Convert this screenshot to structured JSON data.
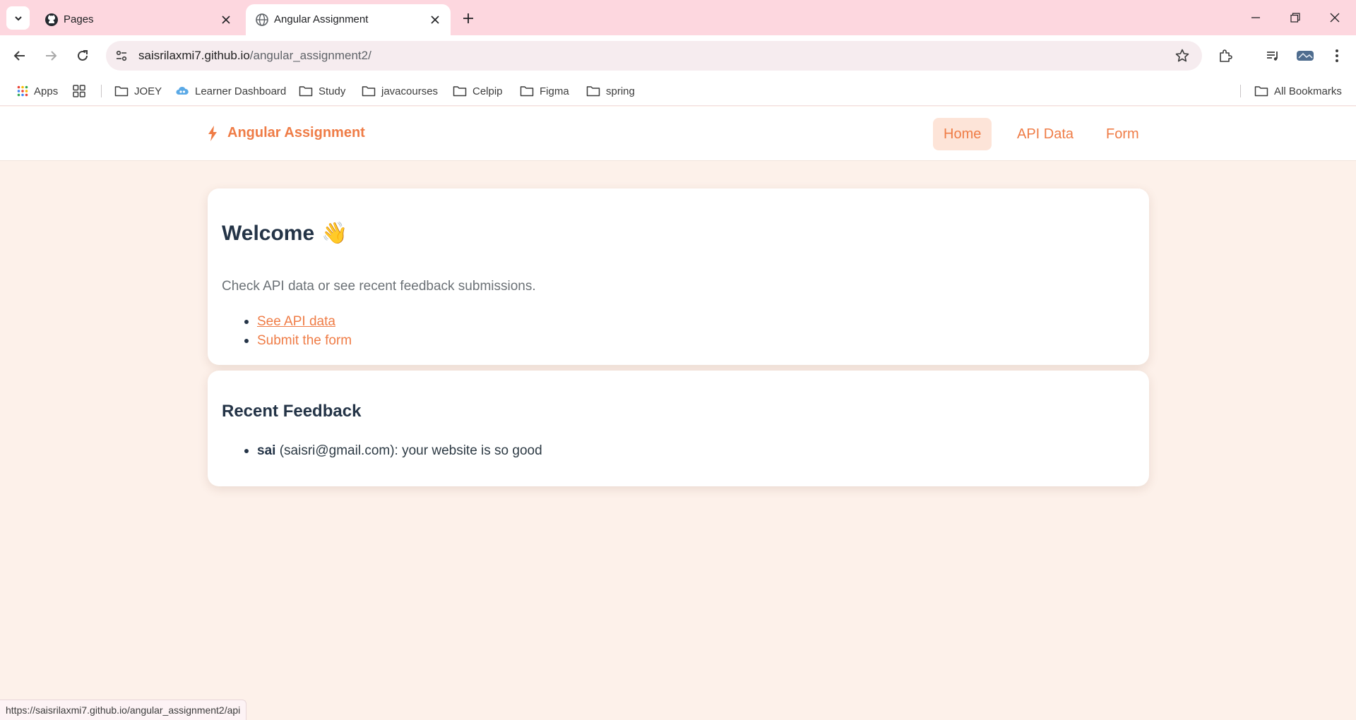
{
  "browser": {
    "tabs": [
      {
        "title": "Pages",
        "icon": "github-icon",
        "active": false
      },
      {
        "title": "Angular Assignment",
        "icon": "globe-icon",
        "active": true
      }
    ],
    "address": {
      "host": "saisrilaxmi7.github.io",
      "path": "/angular_assignment2/"
    },
    "bookmarks": [
      {
        "label": "Apps",
        "icon": "apps-grid-icon"
      },
      {
        "label": "JOEY",
        "icon": "folder-icon"
      },
      {
        "label": "Learner Dashboard",
        "icon": "cloud-icon"
      },
      {
        "label": "Study",
        "icon": "folder-icon"
      },
      {
        "label": "javacourses",
        "icon": "folder-icon"
      },
      {
        "label": "Celpip",
        "icon": "folder-icon"
      },
      {
        "label": "Figma",
        "icon": "folder-icon"
      },
      {
        "label": "spring",
        "icon": "folder-icon"
      }
    ],
    "all_bookmarks": "All Bookmarks",
    "status_url": "https://saisrilaxmi7.github.io/angular_assignment2/api"
  },
  "app": {
    "brand": "Angular Assignment",
    "nav": [
      "Home",
      "API Data",
      "Form"
    ],
    "active_nav": "Home",
    "welcome": {
      "title": "Welcome",
      "emoji": "👋",
      "subtitle": "Check API data or see recent feedback submissions.",
      "links": [
        "See API data",
        "Submit the form"
      ]
    },
    "feedback": {
      "title": "Recent Feedback",
      "items": [
        {
          "name": "sai",
          "detail": "(saisri@gmail.com): your website is so good"
        }
      ]
    }
  },
  "colors": {
    "accent": "#ef7c46",
    "tabstrip": "#fdd7df",
    "page_bg": "#fdf1ea",
    "heading": "#243447"
  }
}
